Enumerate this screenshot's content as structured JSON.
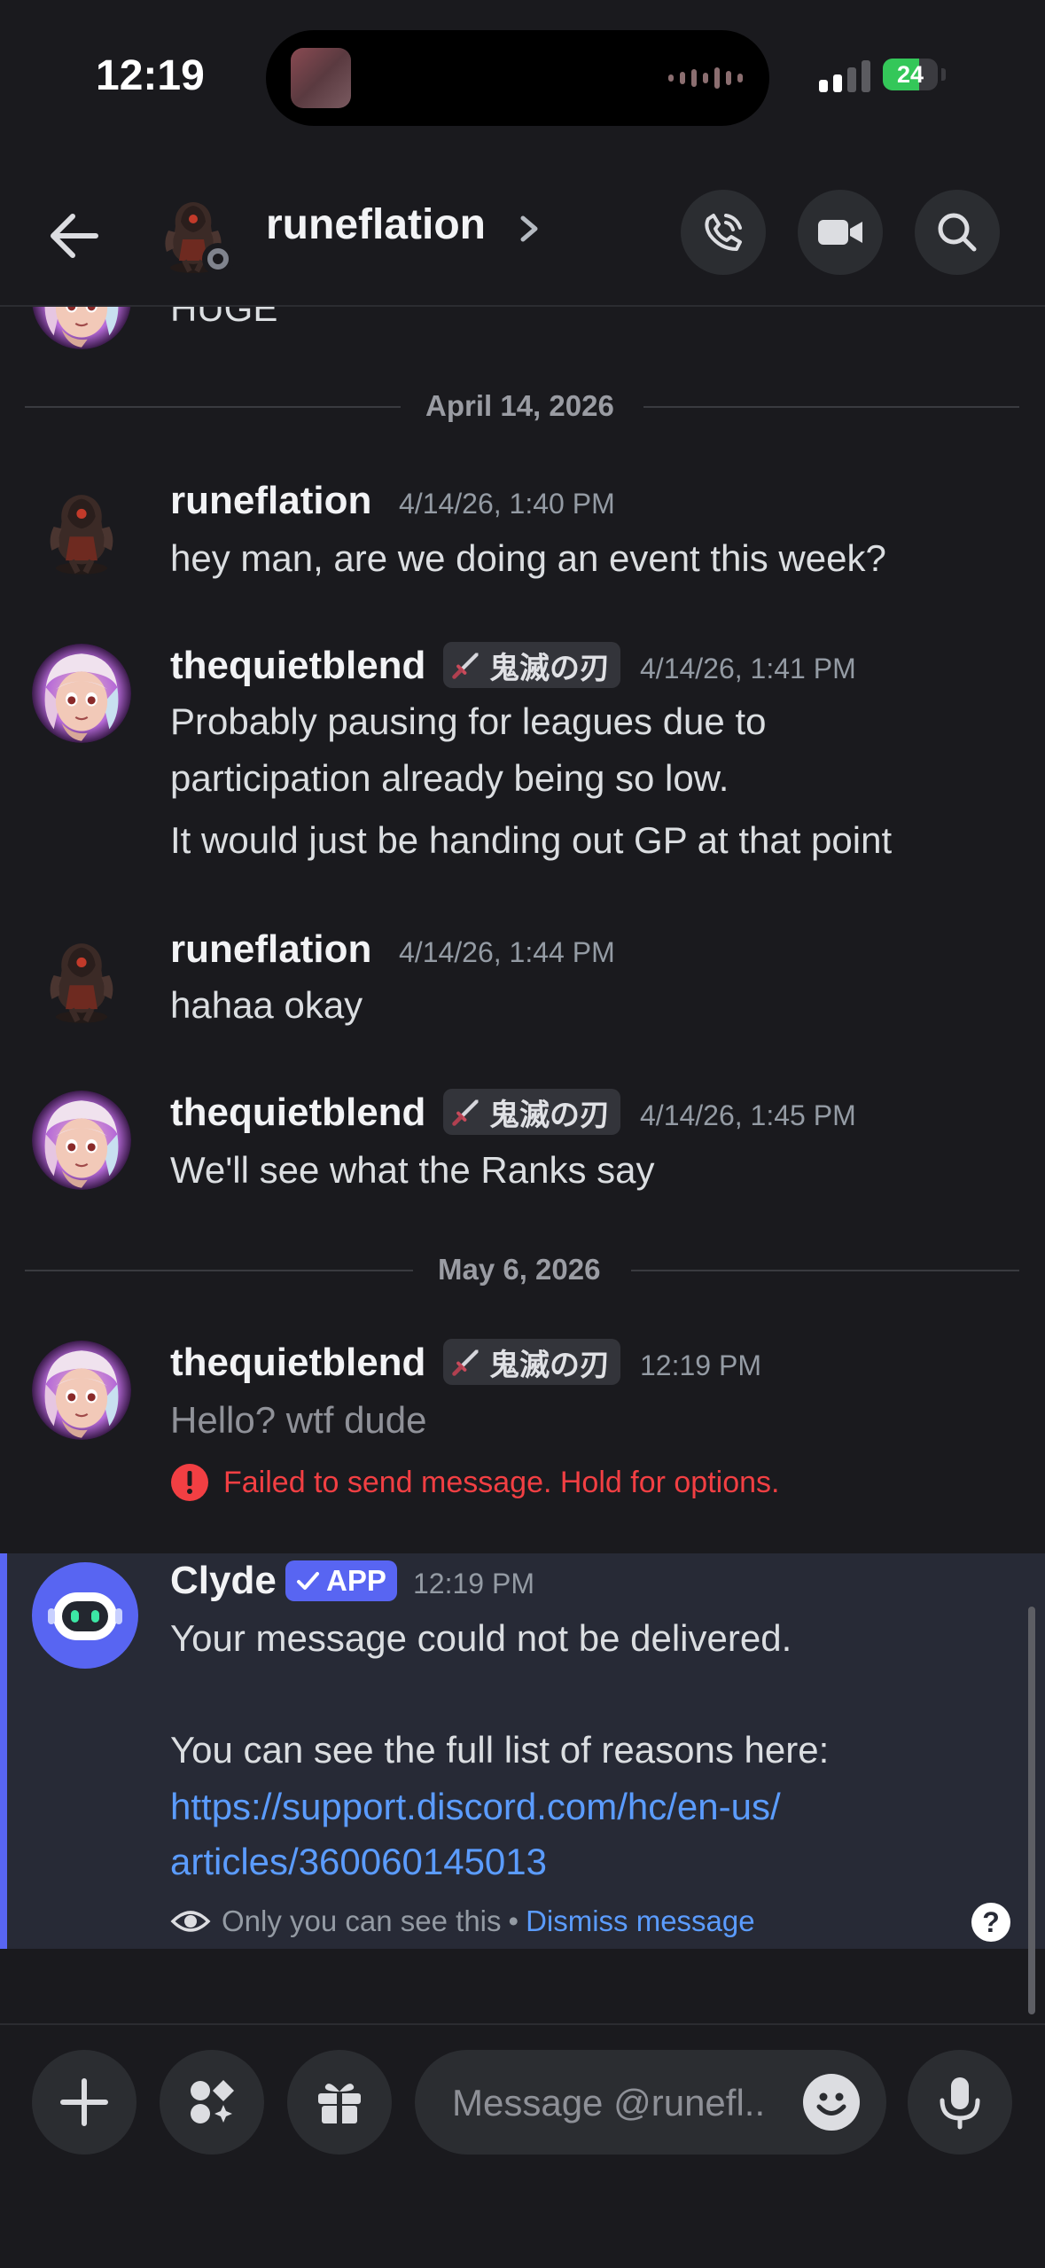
{
  "status_bar": {
    "time": "12:19",
    "battery": "24"
  },
  "header": {
    "title": "runeflation"
  },
  "partial_message": {
    "text": "HUGE"
  },
  "dividers": [
    {
      "label": "April 14, 2026"
    },
    {
      "label": "May 6, 2026"
    }
  ],
  "messages": [
    {
      "author": "runeflation",
      "timestamp": "4/14/26, 1:40 PM",
      "lines": [
        "hey man, are we doing an event this week?"
      ]
    },
    {
      "author": "thequietblend",
      "tag": "鬼滅の刃",
      "timestamp": "4/14/26, 1:41 PM",
      "lines": [
        "Probably pausing for leagues due to",
        "participation already being so low.",
        "It would just be handing out GP at that point"
      ]
    },
    {
      "author": "runeflation",
      "timestamp": "4/14/26, 1:44 PM",
      "lines": [
        "hahaa okay"
      ]
    },
    {
      "author": "thequietblend",
      "tag": "鬼滅の刃",
      "timestamp": "4/14/26, 1:45 PM",
      "lines": [
        "We'll see what the Ranks say"
      ]
    },
    {
      "author": "thequietblend",
      "tag": "鬼滅の刃",
      "timestamp": "12:19 PM",
      "lines": [
        "Hello? wtf dude"
      ],
      "error": "Failed to send message. Hold for options."
    }
  ],
  "clyde": {
    "author": "Clyde",
    "badge": "APP",
    "timestamp": "12:19 PM",
    "line1": "Your message could not be delivered.",
    "line2": "You can see the full list of reasons here:",
    "link_line1": "https://support.discord.com/hc/en-us/",
    "link_line2": "articles/360060145013",
    "visibility": "Only you can see this",
    "separator": "•",
    "dismiss": "Dismiss message"
  },
  "composer": {
    "placeholder": "Message @runefl.."
  },
  "colors": {
    "accent": "#5865f2",
    "link": "#5b9cff",
    "error": "#f23f43",
    "background": "#1a1a1e"
  },
  "icons": [
    "back-arrow-icon",
    "phone-icon",
    "video-camera-icon",
    "search-icon",
    "plus-icon",
    "apps-icon",
    "gift-icon",
    "emoji-icon",
    "microphone-icon",
    "eye-icon",
    "help-icon",
    "error-icon",
    "sword-icon",
    "checkmark-icon"
  ]
}
